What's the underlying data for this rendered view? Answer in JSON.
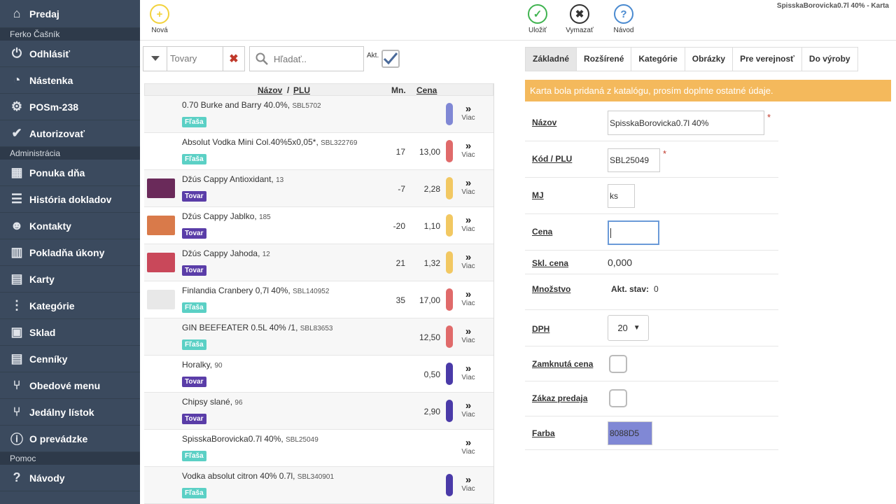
{
  "window_title": "SpisskaBorovicka0.7l 40% - Karta",
  "sidebar": {
    "items": [
      {
        "label": "Predaj",
        "icon": "home-icon"
      },
      {
        "section": "Ferko Čašník"
      },
      {
        "label": "Odhlásiť",
        "icon": "power-icon"
      },
      {
        "label": "Nástenka",
        "icon": "dashboard-icon"
      },
      {
        "label": "POSm-238",
        "icon": "gear-icon"
      },
      {
        "label": "Autorizovať",
        "icon": "check-circle-icon"
      },
      {
        "section": "Administrácia"
      },
      {
        "label": "Ponuka dňa",
        "icon": "grid-star-icon"
      },
      {
        "label": "História dokladov",
        "icon": "list-icon"
      },
      {
        "label": "Kontakty",
        "icon": "users-icon"
      },
      {
        "label": "Pokladňa úkony",
        "icon": "bar-chart-icon"
      },
      {
        "label": "Karty",
        "icon": "cards-icon"
      },
      {
        "label": "Kategórie",
        "icon": "tree-icon"
      },
      {
        "label": "Sklad",
        "icon": "boxes-icon"
      },
      {
        "label": "Cenníky",
        "icon": "pricelist-icon"
      },
      {
        "label": "Obedové menu",
        "icon": "cutlery-icon"
      },
      {
        "label": "Jedálny lístok",
        "icon": "cutlery-icon"
      },
      {
        "label": "O prevádzke",
        "icon": "info-icon"
      },
      {
        "section": "Pomoc"
      },
      {
        "label": "Návody",
        "icon": "question-icon"
      }
    ]
  },
  "toolbar": {
    "new_label": "Nová",
    "save_label": "Uložiť",
    "delete_label": "Vymazať",
    "help_label": "Návod"
  },
  "filter": {
    "category_value": "Tovary",
    "search_placeholder": "Hľadať..",
    "akt_label": "Akt."
  },
  "list": {
    "headers": {
      "name": "Názov",
      "sep": " / ",
      "plu": "PLU",
      "qty": "Mn.",
      "price": "Cena"
    },
    "more_label": "Viac",
    "rows": [
      {
        "name": "0.70 Burke and Barry 40.0%,",
        "code": "SBL5702",
        "tag": "Fľaša",
        "tag_color": "#5bd0c5",
        "qty": "",
        "price": "",
        "bar": "#8088d5",
        "thumb": ""
      },
      {
        "name": "Absolut Vodka Mini Col.40%5x0,05*,",
        "code": "SBL322769",
        "tag": "Fľaša",
        "tag_color": "#5bd0c5",
        "qty": "17",
        "price": "13,00",
        "bar": "#e06a6a",
        "thumb": ""
      },
      {
        "name": "Džús Cappy Antioxidant,",
        "code": "13",
        "tag": "Tovar",
        "tag_color": "#5a3da8",
        "qty": "-7",
        "price": "2,28",
        "bar": "#f2c862",
        "thumb": "#6a2a5a"
      },
      {
        "name": "Džús Cappy Jablko,",
        "code": "185",
        "tag": "Tovar",
        "tag_color": "#5a3da8",
        "qty": "-20",
        "price": "1,10",
        "bar": "#f2c862",
        "thumb": "#d97a4a"
      },
      {
        "name": "Džús Cappy Jahoda,",
        "code": "12",
        "tag": "Tovar",
        "tag_color": "#5a3da8",
        "qty": "21",
        "price": "1,32",
        "bar": "#f2c862",
        "thumb": "#c9485a"
      },
      {
        "name": "Finlandia Cranbery 0,7l 40%,",
        "code": "SBL140952",
        "tag": "Fľaša",
        "tag_color": "#5bd0c5",
        "qty": "35",
        "price": "17,00",
        "bar": "#e06a6a",
        "thumb": "#e8e8e8"
      },
      {
        "name": "GIN BEEFEATER 0.5L 40% /1,",
        "code": "SBL83653",
        "tag": "Fľaša",
        "tag_color": "#5bd0c5",
        "qty": "",
        "price": "12,50",
        "bar": "#e06a6a",
        "thumb": ""
      },
      {
        "name": "Horalky,",
        "code": "90",
        "tag": "Tovar",
        "tag_color": "#5a3da8",
        "qty": "",
        "price": "0,50",
        "bar": "#4a3aa8",
        "thumb": ""
      },
      {
        "name": "Chipsy slané,",
        "code": "96",
        "tag": "Tovar",
        "tag_color": "#5a3da8",
        "qty": "",
        "price": "2,90",
        "bar": "#4a3aa8",
        "thumb": ""
      },
      {
        "name": "SpisskaBorovicka0.7l 40%,",
        "code": "SBL25049",
        "tag": "Fľaša",
        "tag_color": "#5bd0c5",
        "qty": "",
        "price": "",
        "bar": "",
        "thumb": ""
      },
      {
        "name": "Vodka absolut citron 40% 0.7l,",
        "code": "SBL340901",
        "tag": "Fľaša",
        "tag_color": "#5bd0c5",
        "qty": "",
        "price": "",
        "bar": "#4a3aa8",
        "thumb": ""
      }
    ]
  },
  "tabs": [
    "Základné",
    "Rozšírené",
    "Kategórie",
    "Obrázky",
    "Pre verejnosť",
    "Do výroby"
  ],
  "notice": "Karta bola pridaná z katalógu, prosím doplnte ostatné údaje.",
  "form": {
    "name_label": "Názov",
    "name_value": "SpisskaBorovicka0.7l 40%",
    "plu_label": "Kód / PLU",
    "plu_value": "SBL25049",
    "unit_label": "MJ",
    "unit_value": "ks",
    "price_label": "Cena",
    "price_value": "",
    "stock_price_label": "Skl. cena",
    "stock_price_value": "0,000",
    "qty_label": "Množstvo",
    "qty_status_label": "Akt. stav:",
    "qty_status_value": "0",
    "vat_label": "DPH",
    "vat_value": "20",
    "locked_price_label": "Zamknutá cena",
    "no_sale_label": "Zákaz predaja",
    "color_label": "Farba",
    "color_value": "8088D5",
    "color_hex": "#8088d5"
  }
}
